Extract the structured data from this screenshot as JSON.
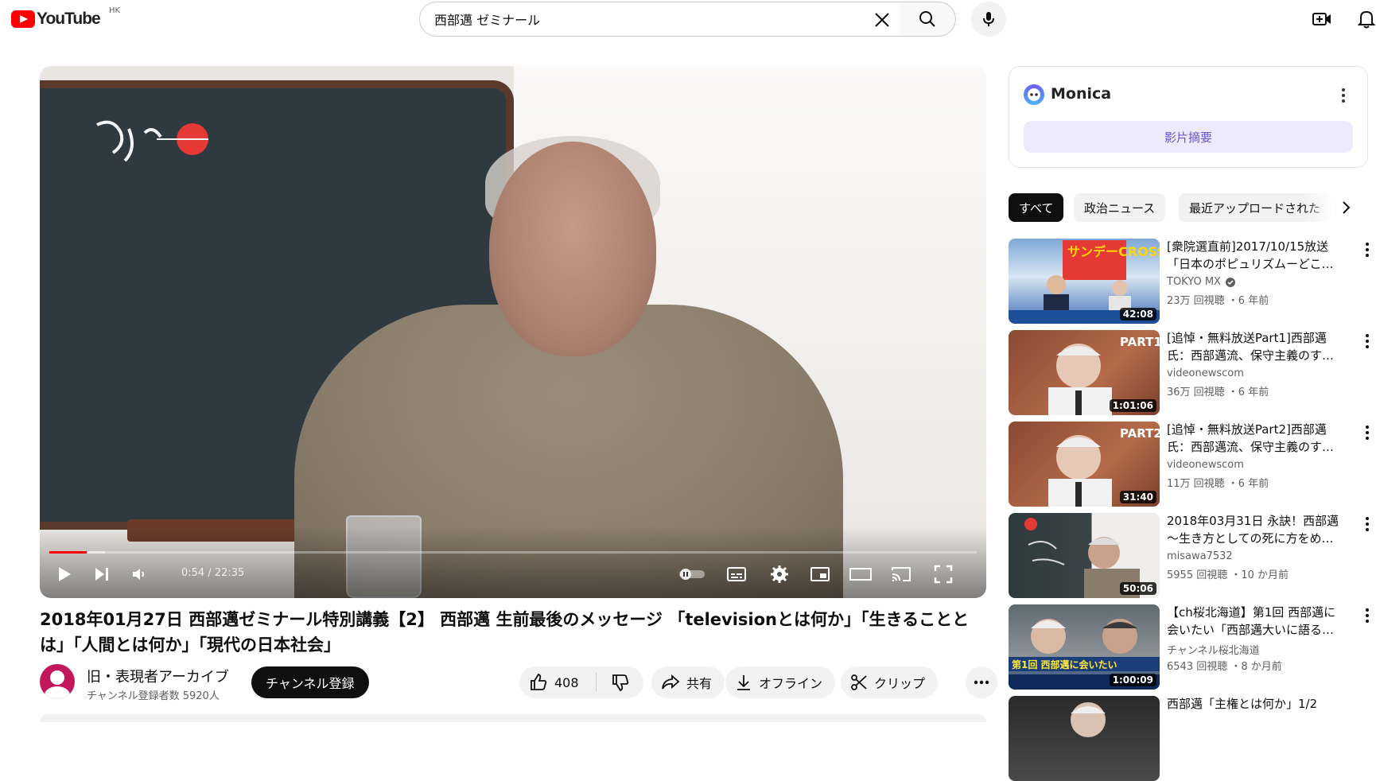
{
  "header": {
    "logo_text": "YouTube",
    "region": "HK",
    "search_value": "西部邁 ゼミナール"
  },
  "player": {
    "time_current": "0:54",
    "time_total": "22:35",
    "time_display": "0:54 / 22:35",
    "progress_played_fraction": 0.04,
    "progress_buffered_fraction": 0.06,
    "accent_color": "#ff0000"
  },
  "video": {
    "title": "2018年01月27日 西部邁ゼミナール特別講義【2】 西部邁 生前最後のメッセージ 「televisionとは何か」「生きることとは」「人間とは何か」「現代の日本社会」",
    "channel_name": "旧・表現者アーカイブ",
    "subscriber_count": "チャンネル登録者数 5920人",
    "subscribe_label": "チャンネル登録",
    "like_count": "408",
    "share_label": "共有",
    "offline_label": "オフライン",
    "clip_label": "クリップ"
  },
  "monica": {
    "title": "Monica",
    "summary_button": "影片摘要"
  },
  "chips": [
    {
      "label": "すべて",
      "active": true
    },
    {
      "label": "政治ニュース",
      "active": false
    },
    {
      "label": "最近アップロードされた",
      "active": false
    }
  ],
  "recommendations": [
    {
      "title": "[衆院選直前]2017/10/15放送「日本のポピュリズムーどこ…",
      "channel": "TOKYO MX",
      "verified": true,
      "meta": "23万 回視聴 ・6 年前",
      "duration": "42:08",
      "thumb_label": "サンデーCROSS"
    },
    {
      "title": "[追悼・無料放送Part1]西部邁氏：西部邁流、保守主義のす…",
      "channel": "videonewscom",
      "verified": false,
      "meta": "36万 回視聴 ・6 年前",
      "duration": "1:01:06",
      "thumb_label": "PART1"
    },
    {
      "title": "[追悼・無料放送Part2]西部邁氏：西部邁流、保守主義のす…",
      "channel": "videonewscom",
      "verified": false,
      "meta": "11万 回視聴 ・6 年前",
      "duration": "31:40",
      "thumb_label": "PART2"
    },
    {
      "title": "2018年03月31日 永訣！西部邁～生き方としての死に方をめ…",
      "channel": "misawa7532",
      "verified": false,
      "meta": "5955 回視聴 ・10 か月前",
      "duration": "50:06",
      "thumb_label": ""
    },
    {
      "title": "【ch桜北海道】第1回 西部邁に会いたい「西部邁大いに語る…",
      "channel": "チャンネル桜北海道",
      "verified": false,
      "meta": "6543 回視聴 ・8 か月前",
      "duration": "1:00:09",
      "thumb_label": "第1回 西部邁に会いたい"
    },
    {
      "title": "西部邁「主権とは何か」1/2",
      "channel": "",
      "verified": false,
      "meta": "",
      "duration": "",
      "thumb_label": ""
    }
  ]
}
